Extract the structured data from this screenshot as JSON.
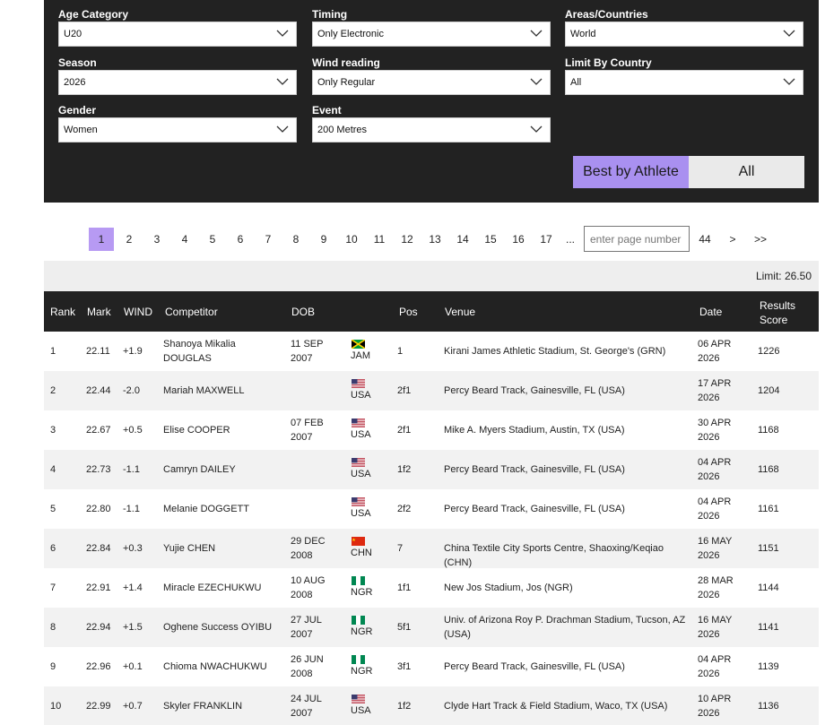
{
  "filters": {
    "age_category": {
      "label": "Age Category",
      "value": "U20"
    },
    "timing": {
      "label": "Timing",
      "value": "Only Electronic"
    },
    "areas": {
      "label": "Areas/Countries",
      "value": "World"
    },
    "season": {
      "label": "Season",
      "value": "2026"
    },
    "wind": {
      "label": "Wind reading",
      "value": "Only Regular"
    },
    "limit_country": {
      "label": "Limit By Country",
      "value": "All"
    },
    "gender": {
      "label": "Gender",
      "value": "Women"
    },
    "event": {
      "label": "Event",
      "value": "200 Metres"
    }
  },
  "toggle": {
    "active": "Best by Athlete",
    "inactive": "All"
  },
  "pagination": {
    "pages": [
      "1",
      "2",
      "3",
      "4",
      "5",
      "6",
      "7",
      "8",
      "9",
      "10",
      "11",
      "12",
      "13",
      "14",
      "15",
      "16",
      "17"
    ],
    "ellipsis": "...",
    "input_placeholder": "enter page number",
    "last": "44",
    "next": ">",
    "end": ">>"
  },
  "limit_text": "Limit: 26.50",
  "columns": {
    "rank": "Rank",
    "mark": "Mark",
    "wind": "WIND",
    "competitor": "Competitor",
    "dob": "DOB",
    "pos": "Pos",
    "venue": "Venue",
    "date": "Date",
    "score_1": "Results",
    "score_2": "Score"
  },
  "rows": [
    {
      "rank": "1",
      "mark": "22.11",
      "wind": "+1.9",
      "name_1": "Shanoya Mikalia",
      "name_2": "DOUGLAS",
      "dob_1": "11 SEP",
      "dob_2": "2007",
      "nat": "JAM",
      "flag": "jamaica-flag-icon",
      "pos": "1",
      "venue_1": "Kirani James Athletic Stadium, St. George's (GRN)",
      "venue_2": "",
      "date_1": "06 APR",
      "date_2": "2026",
      "score": "1226"
    },
    {
      "rank": "2",
      "mark": "22.44",
      "wind": "-2.0",
      "name_1": "Mariah MAXWELL",
      "name_2": "",
      "dob_1": "",
      "dob_2": "",
      "nat": "USA",
      "flag": "usa-flag-icon",
      "pos": "2f1",
      "venue_1": "Percy Beard Track, Gainesville, FL (USA)",
      "venue_2": "",
      "date_1": "17 APR",
      "date_2": "2026",
      "score": "1204"
    },
    {
      "rank": "3",
      "mark": "22.67",
      "wind": "+0.5",
      "name_1": "Elise COOPER",
      "name_2": "",
      "dob_1": "07 FEB",
      "dob_2": "2007",
      "nat": "USA",
      "flag": "usa-flag-icon",
      "pos": "2f1",
      "venue_1": "Mike A. Myers Stadium, Austin, TX (USA)",
      "venue_2": "",
      "date_1": "30 APR",
      "date_2": "2026",
      "score": "1168"
    },
    {
      "rank": "4",
      "mark": "22.73",
      "wind": "-1.1",
      "name_1": "Camryn DAILEY",
      "name_2": "",
      "dob_1": "",
      "dob_2": "",
      "nat": "USA",
      "flag": "usa-flag-icon",
      "pos": "1f2",
      "venue_1": "Percy Beard Track, Gainesville, FL (USA)",
      "venue_2": "",
      "date_1": "04 APR",
      "date_2": "2026",
      "score": "1168"
    },
    {
      "rank": "5",
      "mark": "22.80",
      "wind": "-1.1",
      "name_1": "Melanie DOGGETT",
      "name_2": "",
      "dob_1": "",
      "dob_2": "",
      "nat": "USA",
      "flag": "usa-flag-icon",
      "pos": "2f2",
      "venue_1": "Percy Beard Track, Gainesville, FL (USA)",
      "venue_2": "",
      "date_1": "04 APR",
      "date_2": "2026",
      "score": "1161"
    },
    {
      "rank": "6",
      "mark": "22.84",
      "wind": "+0.3",
      "name_1": "Yujie CHEN",
      "name_2": "",
      "dob_1": "29 DEC",
      "dob_2": "2008",
      "nat": "CHN",
      "flag": "china-flag-icon",
      "pos": "7",
      "venue_1": "China Textile City Sports Centre, Shaoxing/Keqiao (CHN)",
      "venue_2": "",
      "date_1": "16 MAY",
      "date_2": "2026",
      "score": "1151"
    },
    {
      "rank": "7",
      "mark": "22.91",
      "wind": "+1.4",
      "name_1": "Miracle EZECHUKWU",
      "name_2": "",
      "dob_1": "10 AUG",
      "dob_2": "2008",
      "nat": "NGR",
      "flag": "nigeria-flag-icon",
      "pos": "1f1",
      "venue_1": "New Jos Stadium, Jos (NGR)",
      "venue_2": "",
      "date_1": "28 MAR",
      "date_2": "2026",
      "score": "1144"
    },
    {
      "rank": "8",
      "mark": "22.94",
      "wind": "+1.5",
      "name_1": "Oghene Success OYIBU",
      "name_2": "",
      "dob_1": "27 JUL",
      "dob_2": "2007",
      "nat": "NGR",
      "flag": "nigeria-flag-icon",
      "pos": "5f1",
      "venue_1": "Univ. of Arizona Roy P. Drachman Stadium, Tucson, AZ",
      "venue_2": "(USA)",
      "date_1": "16 MAY",
      "date_2": "2026",
      "score": "1141"
    },
    {
      "rank": "9",
      "mark": "22.96",
      "wind": "+0.1",
      "name_1": "Chioma NWACHUKWU",
      "name_2": "",
      "dob_1": "26 JUN",
      "dob_2": "2008",
      "nat": "NGR",
      "flag": "nigeria-flag-icon",
      "pos": "3f1",
      "venue_1": "Percy Beard Track, Gainesville, FL (USA)",
      "venue_2": "",
      "date_1": "04 APR",
      "date_2": "2026",
      "score": "1139"
    },
    {
      "rank": "10",
      "mark": "22.99",
      "wind": "+0.7",
      "name_1": "Skyler FRANKLIN",
      "name_2": "",
      "dob_1": "24 JUL",
      "dob_2": "2007",
      "nat": "USA",
      "flag": "usa-flag-icon",
      "pos": "1f2",
      "venue_1": "Clyde Hart Track & Field Stadium, Waco, TX (USA)",
      "venue_2": "",
      "date_1": "10 APR",
      "date_2": "2026",
      "score": "1136"
    }
  ],
  "colors": {
    "panel": "#222222",
    "accent": "#a990f0",
    "page_active": "#b79af3"
  }
}
